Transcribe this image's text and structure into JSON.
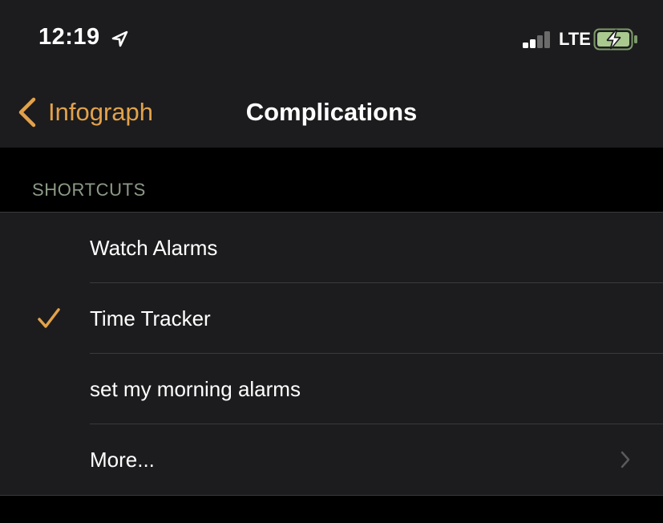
{
  "status_bar": {
    "time": "12:19",
    "network": "LTE",
    "icons": [
      "location-arrow-icon",
      "signal-strength-icon",
      "battery-charging-icon"
    ]
  },
  "nav": {
    "back_label": "Infograph",
    "title": "Complications"
  },
  "section": {
    "header": "SHORTCUTS"
  },
  "list": {
    "items": [
      {
        "label": "Watch Alarms",
        "selected": false
      },
      {
        "label": "Time Tracker",
        "selected": true
      },
      {
        "label": "set my morning alarms",
        "selected": false
      },
      {
        "label": "More...",
        "disclosure": true
      }
    ]
  },
  "colors": {
    "accent": "#e2a24b",
    "background": "#000000",
    "grouped_background": "#1c1c1e",
    "separator": "#3a3a3c",
    "section_header": "#8c9a87",
    "battery_green": "#a9c98f"
  }
}
